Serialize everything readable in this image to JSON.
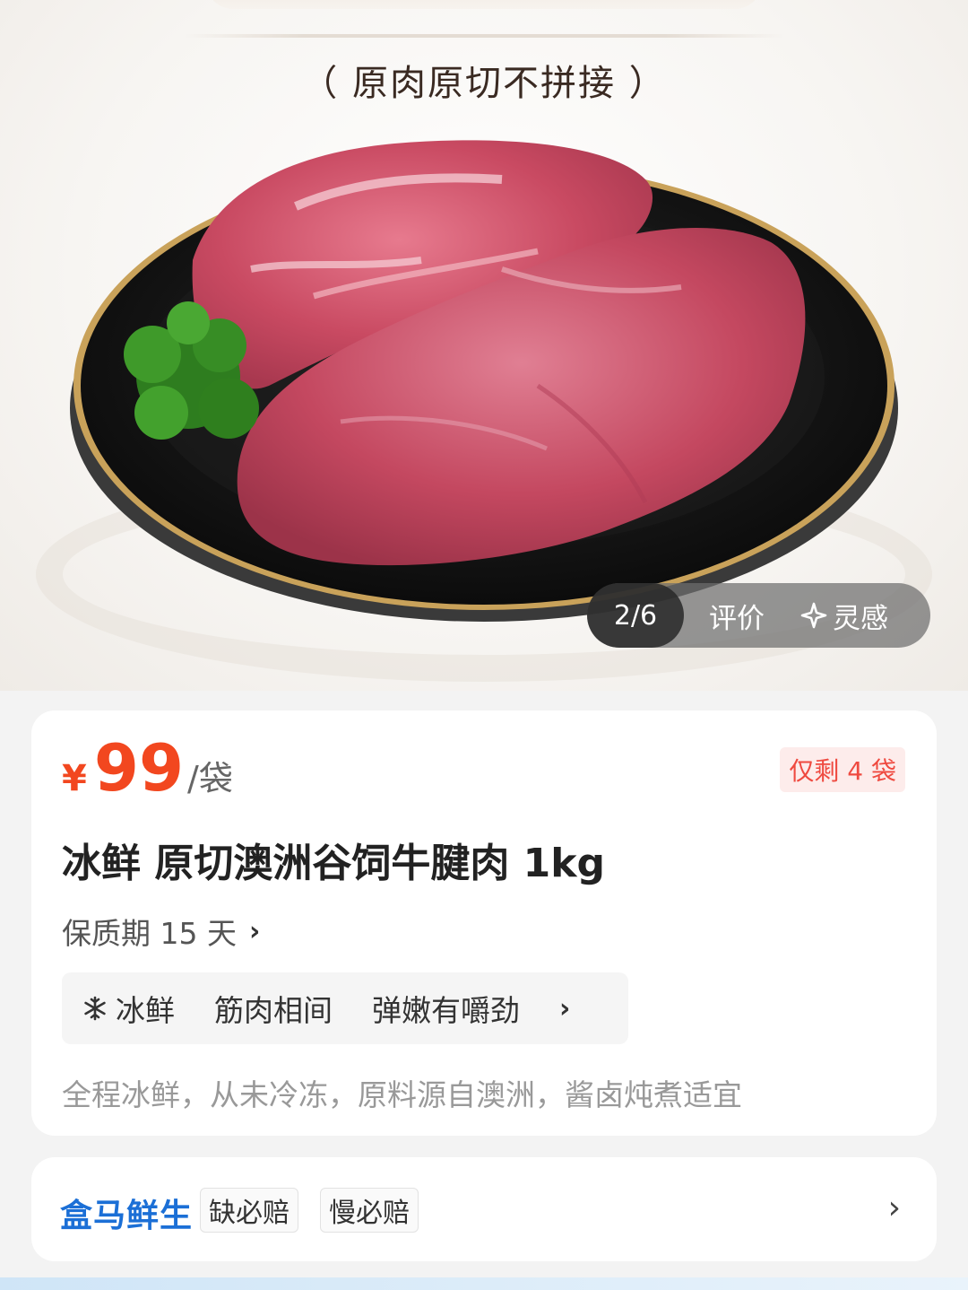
{
  "hero": {
    "subtitle": "（ 原肉原切不拼接 ）",
    "gallery": {
      "counter": "2/6",
      "reviews_tab": "评价",
      "inspiration_tab": "灵感"
    }
  },
  "product": {
    "price_symbol": "¥",
    "price": "99",
    "price_unit": "/袋",
    "stock_badge": "仅剩 4 袋",
    "title": "冰鲜 原切澳洲谷饲牛腱肉 1kg",
    "shelf_life": "保质期 15 天",
    "tags": [
      "冰鲜",
      "筋肉相间",
      "弹嫩有嚼劲"
    ],
    "description": "全程冰鲜，从未冷冻，原料源自澳洲，酱卤炖煮适宜"
  },
  "service": {
    "brand": "盒马鲜生",
    "badges": [
      "缺必赔",
      "慢必赔"
    ]
  },
  "colors": {
    "price_accent": "#f2471f",
    "stock_badge_text": "#ef4a40",
    "brand_blue": "#1b6fd6"
  },
  "icons": {
    "snowflake": "snowflake-icon",
    "sparkle": "sparkle-icon",
    "chevron": "chevron-right-icon"
  }
}
